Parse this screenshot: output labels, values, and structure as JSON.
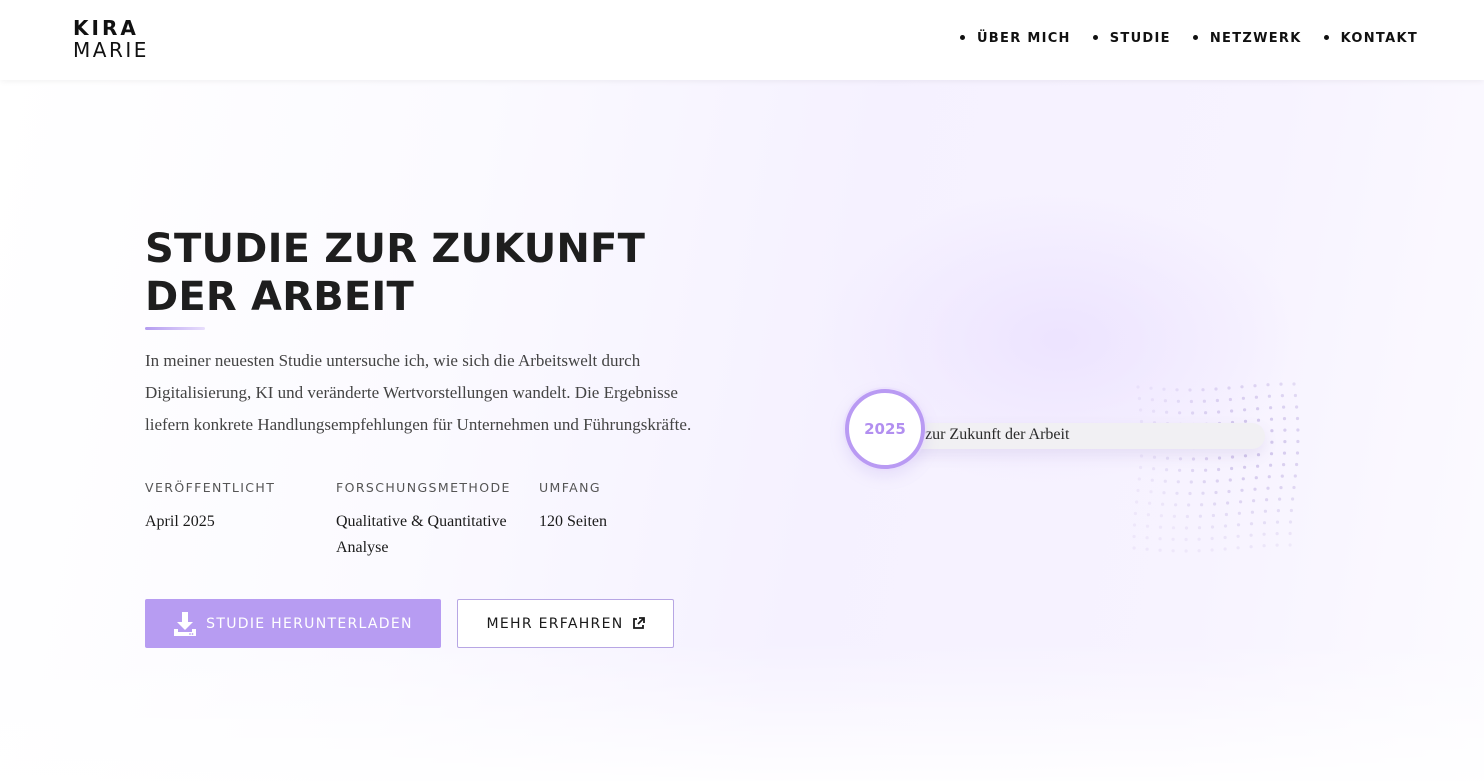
{
  "logo": {
    "line1": "KIRA",
    "line2": "MARIE"
  },
  "nav": {
    "items": [
      {
        "label": "ÜBER MICH"
      },
      {
        "label": "STUDIE"
      },
      {
        "label": "NETZWERK"
      },
      {
        "label": "KONTAKT"
      }
    ]
  },
  "hero": {
    "title_line1": "STUDIE ZUR ZUKUNFT",
    "title_line2": "DER ARBEIT",
    "description": "In meiner neuesten Studie untersuche ich, wie sich die Arbeitswelt durch Digitalisierung, KI und veränderte Wertvorstellungen wandelt. Die Ergebnisse liefern konkrete Handlungsempfehlungen für Unternehmen und Führungskräfte.",
    "meta": [
      {
        "label": "VERÖFFENTLICHT",
        "value": "April 2025"
      },
      {
        "label": "FORSCHUNGSMETHODE",
        "value": "Qualitative & Quantitative Analyse"
      },
      {
        "label": "UMFANG",
        "value": "120 Seiten"
      }
    ],
    "download_button": "STUDIE HERUNTERLADEN",
    "more_button": "MEHR ERFAHREN"
  },
  "visual": {
    "year": "2025",
    "pill_text": "zur Zukunft der Arbeit"
  },
  "colors": {
    "accent": "#b79cf2",
    "accent_dark": "#b28ff0",
    "text": "#1a1a1a"
  },
  "icons": {
    "download": "download-icon",
    "external": "external-link-icon"
  }
}
